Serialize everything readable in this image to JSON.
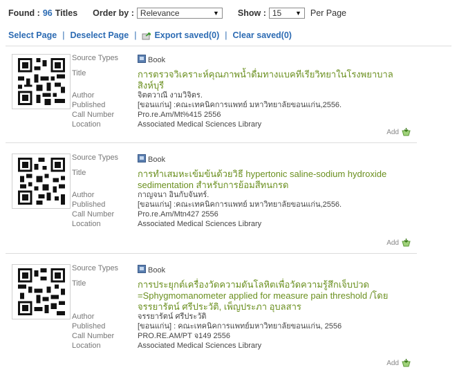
{
  "top": {
    "found_label": "Found :",
    "found_count": "96",
    "titles_label": "Titles",
    "order_label": "Order by :",
    "order_value": "Relevance",
    "show_label": "Show :",
    "show_value": "15",
    "per_page_label": "Per Page"
  },
  "actions": {
    "select_page": "Select Page",
    "deselect_page": "Deselect Page",
    "export_saved": "Export saved(0)",
    "clear_saved": "Clear saved(0)",
    "sep": "|"
  },
  "labels": {
    "source_types": "Source Types",
    "title": "Title",
    "author": "Author",
    "published": "Published",
    "call_number": "Call Number",
    "location": "Location",
    "add": "Add"
  },
  "records": [
    {
      "source_type": "Book",
      "title": "การตรวจวิเคราะห์คุณภาพน้ำดื่มทางแบคทีเรียวิทยาในโรงพยาบาลสิงห์บุรี",
      "author": "จิตตวาณี งามวิจิตร.",
      "published": "[ขอนแก่น] :คณะเทคนิคการแพทย์ มหาวิทยาลัยขอนแก่น,2556.",
      "call_number": "Pro.re.Am/Mt%415 2556",
      "location": "Associated Medical Sciences Library"
    },
    {
      "source_type": "Book",
      "title": "การทำเสมหะเข้มข้นด้วยวิธี hypertonic saline-sodium hydroxide sedimentation สำหรับการย้อมสีทนกรด",
      "author": "กาญจนา อินกับจันทร์.",
      "published": "[ขอนแก่น] :คณะเทคนิคการแพทย์ มหาวิทยาลัยขอนแก่น,2556.",
      "call_number": "Pro.re.Am/Mtn427 2556",
      "location": "Associated Medical Sciences Library"
    },
    {
      "source_type": "Book",
      "title": "การประยุกต์เครื่องวัดความดันโลหิตเพื่อวัดความรู้สึกเจ็บปวด =Sphygmomanometer applied for measure pain threshold /โดย จรรยารัตน์ ศรีประวัติ, เพ็ญประภา อุบลสาร",
      "author": "จรรยารัตน์ ศรีประวัติ",
      "published": "[ขอนแก่น] : คณะเทคนิคการแพทย์มหาวิทยาลัยขอนแก่น, 2556",
      "call_number": "PRO.RE.AM/PT จ149 2556",
      "location": "Associated Medical Sciences Library"
    }
  ]
}
